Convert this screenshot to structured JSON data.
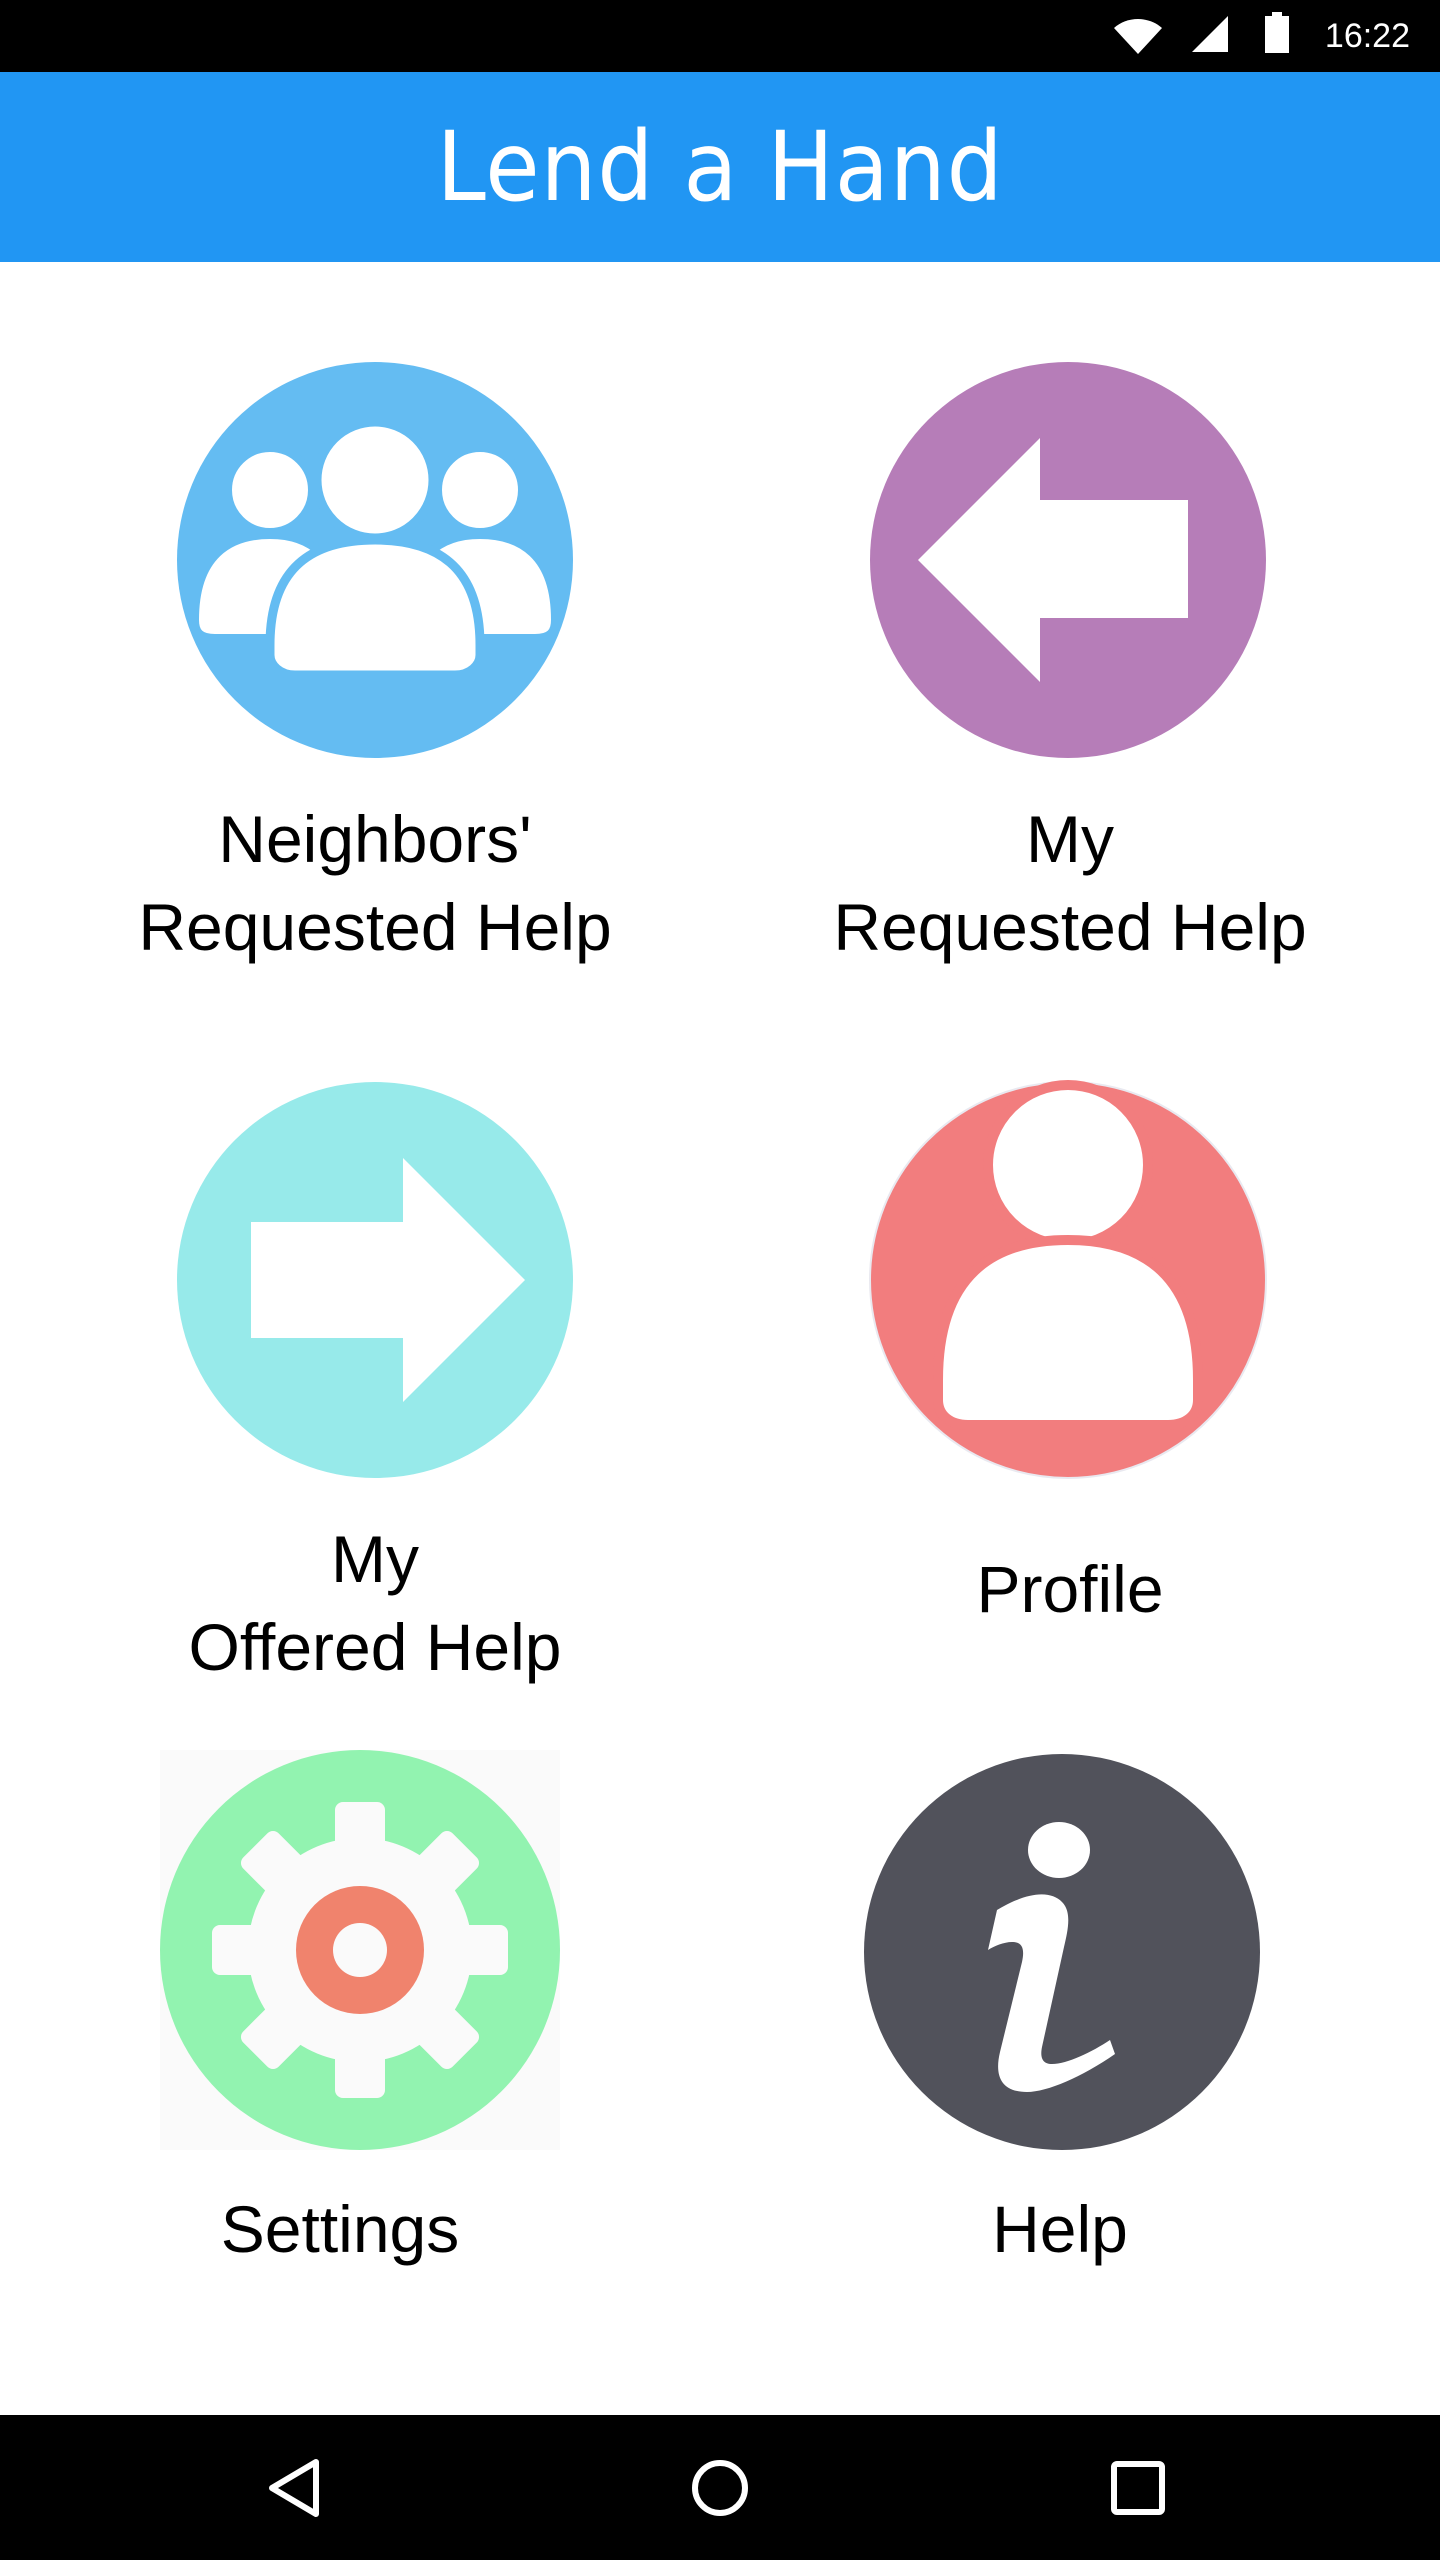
{
  "status_bar": {
    "time": "16:22",
    "icons": [
      "wifi-icon",
      "cell-signal-icon",
      "battery-icon"
    ]
  },
  "app_bar": {
    "title": "Lend a Hand",
    "color": "#2196f3"
  },
  "menu": {
    "neighbors_requested": {
      "line1": "Neighbors'",
      "line2": "Requested Help",
      "icon": "group-icon",
      "color": "#64bcf2"
    },
    "my_requested": {
      "line1": "My",
      "line2": "Requested Help",
      "icon": "arrow-left-icon",
      "color": "#b67db8"
    },
    "my_offered": {
      "line1": "My",
      "line2": "Offered Help",
      "icon": "arrow-right-icon",
      "color": "#97eaea"
    },
    "profile": {
      "label": "Profile",
      "icon": "person-icon",
      "color": "#f27d7e"
    },
    "settings": {
      "label": "Settings",
      "icon": "gear-icon",
      "color": "#92f3b0",
      "accent": "#f0836d"
    },
    "help": {
      "label": "Help",
      "icon": "info-icon",
      "color": "#51525b"
    }
  },
  "nav_bar": {
    "buttons": [
      "back-icon",
      "home-icon",
      "recents-icon"
    ]
  }
}
